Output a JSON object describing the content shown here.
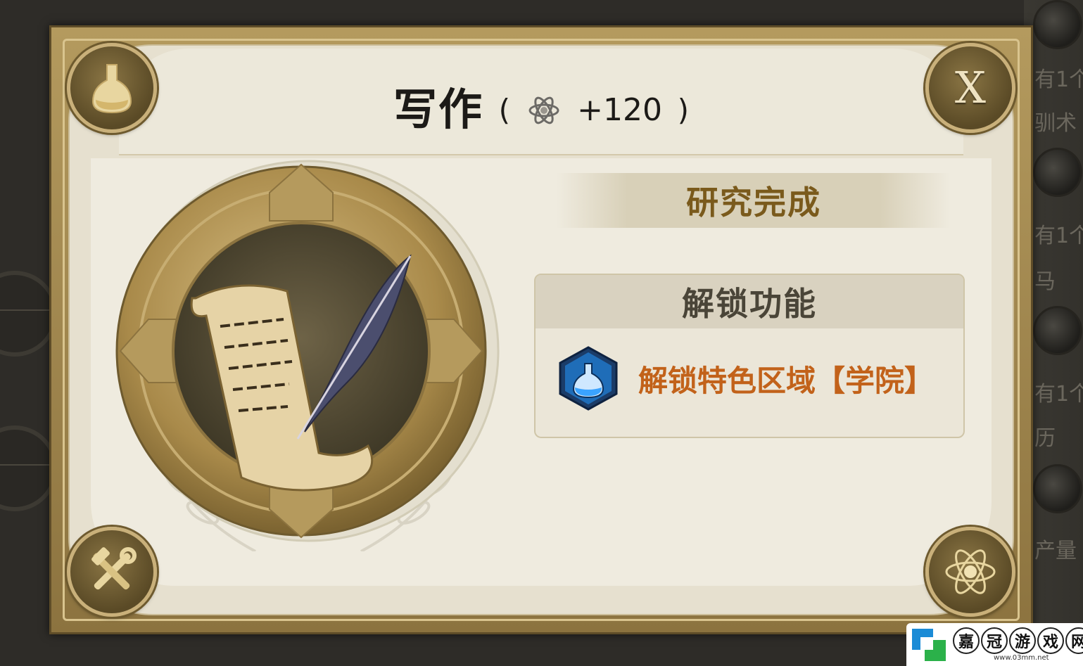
{
  "background": {
    "right_texts": [
      "有1个",
      "驯术",
      "有1个",
      "马",
      "有1个",
      "历",
      "产量"
    ]
  },
  "dialog": {
    "title": "写作",
    "reward_open": "(",
    "reward_value": "+120",
    "reward_close": ")",
    "reward_icon": "science-atom-icon",
    "close_label": "X",
    "status": "研究完成",
    "unlock_header": "解锁功能",
    "unlock_item": "解锁特色区域【学院】",
    "unlock_icon": "flask-hex-icon",
    "tech_icon": "scroll-quill-icon",
    "corner_icons": [
      "flask-icon",
      "close-icon",
      "tools-icon",
      "atom-icon"
    ]
  },
  "colors": {
    "frame": "#a88c52",
    "parchment": "#e6e0cf",
    "status_text": "#7a5a1c",
    "unlock_item_text": "#c2621a",
    "hex_icon_blue": "#1f6db8"
  },
  "watermark": {
    "chars": [
      "嘉",
      "冠",
      "游",
      "戏",
      "网"
    ],
    "url": "www.03mm.net"
  }
}
